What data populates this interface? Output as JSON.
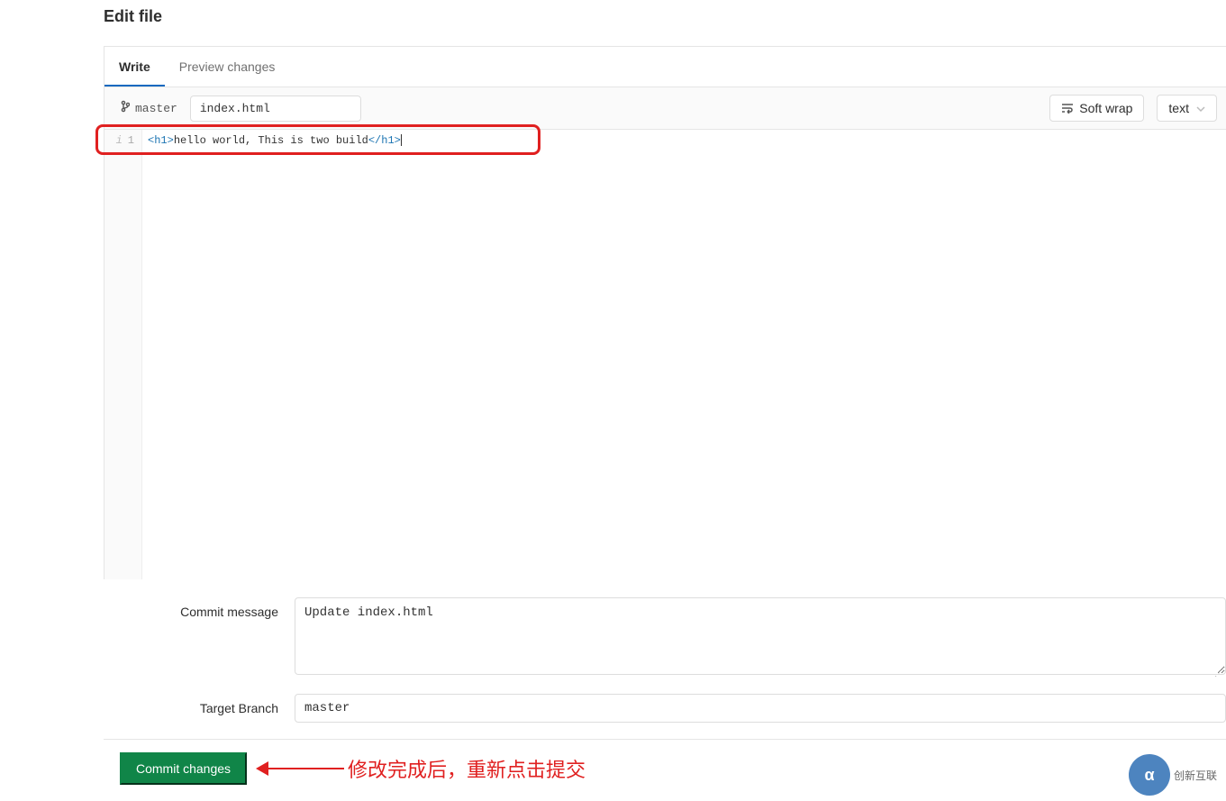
{
  "page_title": "Edit file",
  "tabs": {
    "write": "Write",
    "preview": "Preview changes"
  },
  "branch_name": "master",
  "filename_value": "index.html",
  "toolbar": {
    "soft_wrap": "Soft wrap",
    "syntax_mode": "text"
  },
  "editor": {
    "gutter_info_glyph": "i",
    "line_number": "1",
    "code_open_tag": "<h1>",
    "code_text": "hello world, This is two build",
    "code_close_tag": "</h1>"
  },
  "commit_form": {
    "message_label": "Commit message",
    "message_value": "Update index.html",
    "branch_label": "Target Branch",
    "branch_value": "master"
  },
  "commit_button": "Commit changes",
  "annotation": "修改完成后，重新点击提交",
  "watermark": {
    "icon_text": "α",
    "label": "创新互联"
  }
}
